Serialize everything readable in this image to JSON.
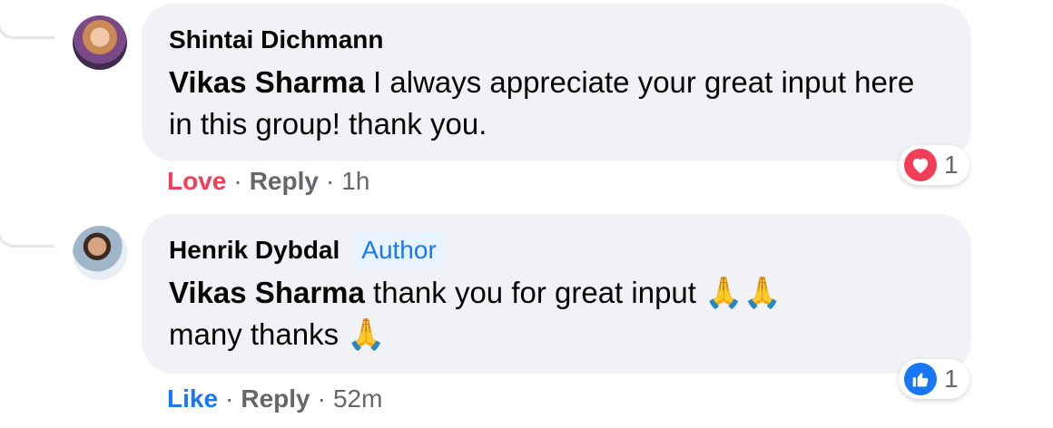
{
  "comments": [
    {
      "author": "Shintai Dichmann",
      "badge": "",
      "mention": "Vikas Sharma",
      "text": " I always appreciate your great input here in this group! thank you.",
      "reaction_count": "1",
      "reaction_type": "love-icon",
      "reaction_color": "#f33e58",
      "action_react": "Love",
      "action_reply": "Reply",
      "time": "1h"
    },
    {
      "author": "Henrik Dybdal",
      "badge": "Author",
      "mention": "Vikas Sharma",
      "text_line1": " thank you for great input ",
      "emoji1": "🙏🙏",
      "text_line2": "many thanks ",
      "emoji2": "🙏",
      "reaction_count": "1",
      "reaction_type": "like-icon",
      "reaction_color": "#1877f2",
      "action_react": "Like",
      "action_reply": "Reply",
      "time": "52m"
    }
  ],
  "separator": "·",
  "colors": {
    "bubble": "#f0f2f5",
    "love": "#f33e58",
    "like": "#1877f2",
    "muted": "#65676b",
    "badge_bg": "#e7f3ff"
  }
}
